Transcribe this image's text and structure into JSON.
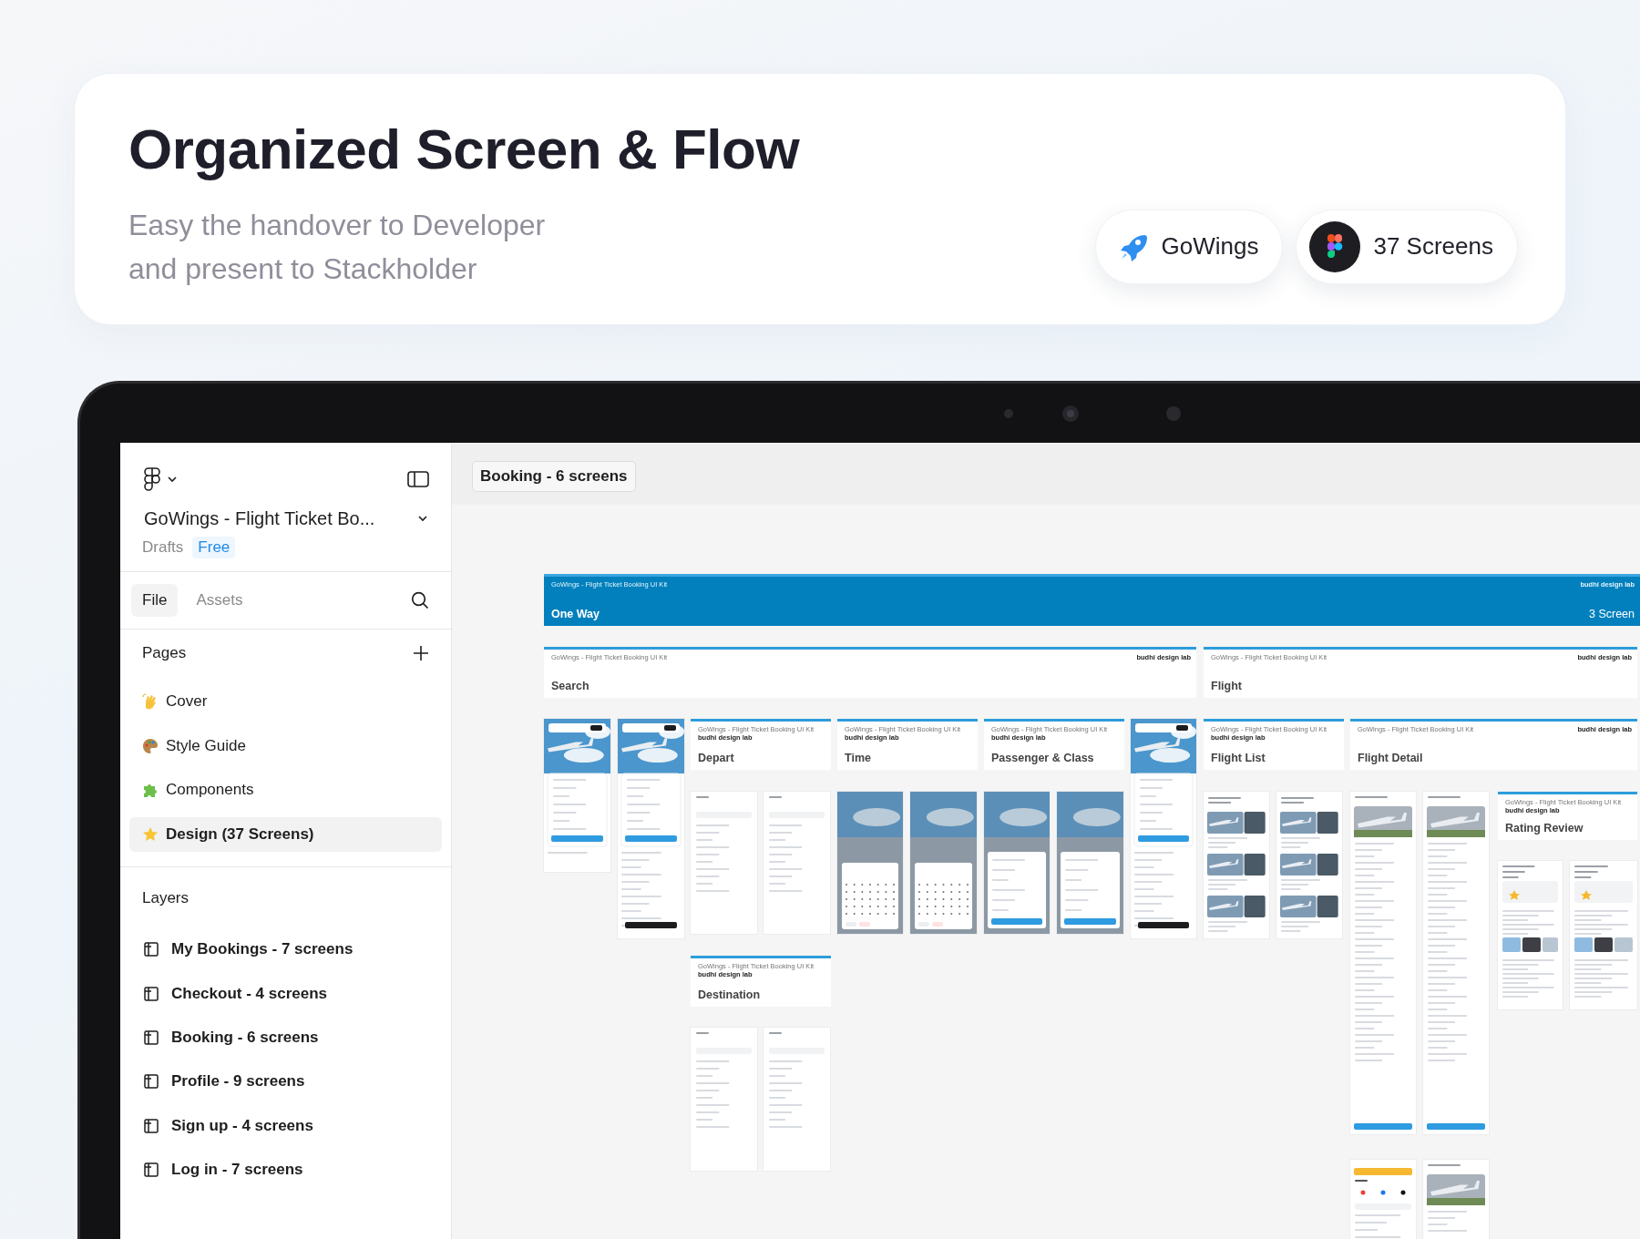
{
  "hero": {
    "title": "Organized Screen & Flow",
    "subtitle_lines": [
      "Easy the handover to Developer",
      "and present to Stackholder"
    ],
    "badges": [
      {
        "label": "GoWings"
      },
      {
        "label": "37 Screens"
      }
    ]
  },
  "sidebar": {
    "file_title": "GoWings - Flight Ticket Bo...",
    "location": "Drafts",
    "plan": "Free",
    "tabs": [
      {
        "label": "File",
        "selected": true
      },
      {
        "label": "Assets",
        "selected": false
      }
    ],
    "pages_heading": "Pages",
    "pages": [
      {
        "label": "Cover",
        "selected": false
      },
      {
        "label": "Style Guide",
        "selected": false
      },
      {
        "label": "Components",
        "selected": false
      },
      {
        "label": "Design (37 Screens)",
        "selected": true
      }
    ],
    "layers_heading": "Layers",
    "layers": [
      {
        "label": "My Bookings - 7 screens"
      },
      {
        "label": "Checkout - 4 screens"
      },
      {
        "label": "Booking - 6 screens"
      },
      {
        "label": "Profile - 9 screens"
      },
      {
        "label": "Sign up - 4 screens"
      },
      {
        "label": "Log in - 7 screens"
      }
    ]
  },
  "canvas": {
    "section_label": "Booking - 6 screens",
    "frames": [
      {
        "kind": "banner",
        "kit": "GoWings - Flight Ticket Booking UI Kit",
        "credit": "budhi design lab",
        "title": "One Way",
        "count": "3 Screen"
      },
      {
        "kind": "header",
        "kit": "GoWings - Flight Ticket Booking UI Kit",
        "credit": "budhi design lab",
        "title": "Search"
      },
      {
        "kind": "header",
        "kit": "GoWings - Flight Ticket Booking UI Kit",
        "credit": "budhi design lab",
        "title": "Flight"
      },
      {
        "kind": "home"
      },
      {
        "kind": "home"
      },
      {
        "kind": "header",
        "kit": "GoWings - Flight Ticket Booking UI Kit",
        "credit": "budhi design lab",
        "title": "Depart"
      },
      {
        "kind": "header",
        "kit": "GoWings - Flight Ticket Booking UI Kit",
        "credit": "budhi design lab",
        "title": "Time"
      },
      {
        "kind": "header",
        "kit": "GoWings - Flight Ticket Booking UI Kit",
        "credit": "budhi design lab",
        "title": "Passenger & Class"
      },
      {
        "kind": "home"
      },
      {
        "kind": "header",
        "kit": "GoWings - Flight Ticket Booking UI Kit",
        "credit": "budhi design lab",
        "title": "Flight List"
      },
      {
        "kind": "header",
        "kit": "GoWings - Flight Ticket Booking UI Kit",
        "credit": "budhi design lab",
        "title": "Flight Detail"
      },
      {
        "kind": "search"
      },
      {
        "kind": "search"
      },
      {
        "kind": "calendar"
      },
      {
        "kind": "calendar"
      },
      {
        "kind": "sheet"
      },
      {
        "kind": "sheet"
      },
      {
        "kind": "results"
      },
      {
        "kind": "results"
      },
      {
        "kind": "detail"
      },
      {
        "kind": "detail"
      },
      {
        "kind": "header",
        "kit": "GoWings - Flight Ticket Booking UI Kit",
        "credit": "budhi design lab",
        "title": "Rating Review"
      },
      {
        "kind": "review"
      },
      {
        "kind": "review"
      },
      {
        "kind": "header",
        "kit": "GoWings - Flight Ticket Booking UI Kit",
        "credit": "budhi design lab",
        "title": "Destination"
      },
      {
        "kind": "search"
      },
      {
        "kind": "search"
      },
      {
        "kind": "login"
      },
      {
        "kind": "detail"
      }
    ]
  }
}
